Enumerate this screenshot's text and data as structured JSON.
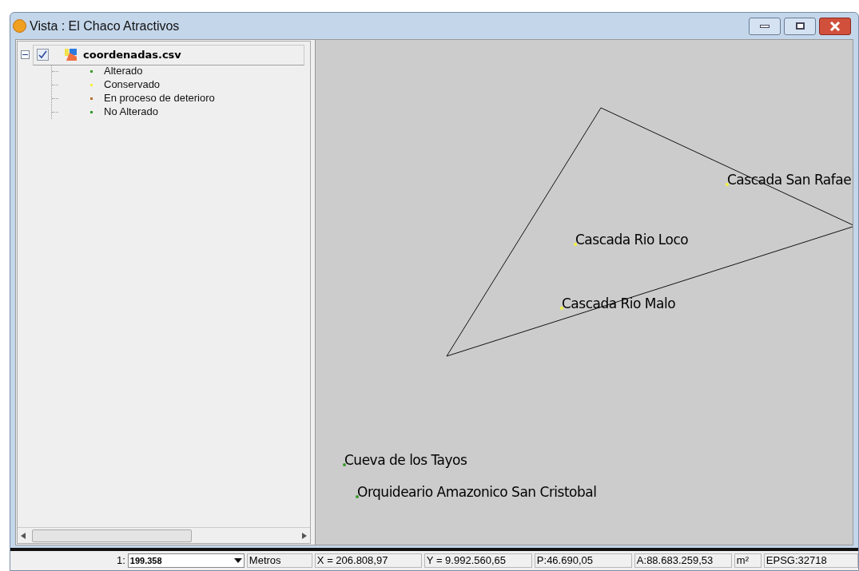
{
  "window": {
    "title": "Vista : El Chaco Atractivos"
  },
  "layers": [
    {
      "name": "coordenadas.csv",
      "checked": true,
      "expanded": true,
      "legend": [
        {
          "label": "Alterado",
          "color": "#3c9c2c"
        },
        {
          "label": "Conservado",
          "color": "#f2f23c"
        },
        {
          "label": "En proceso de deterioro",
          "color": "#b8702c"
        },
        {
          "label": "No Alterado",
          "color": "#2c9a2c"
        }
      ]
    }
  ],
  "map": {
    "features": [
      {
        "kind": "polygon"
      },
      {
        "kind": "point",
        "label": "Cascada San Rafae",
        "color": "#f2f23c"
      },
      {
        "kind": "point",
        "label": "Cascada Rio Loco",
        "color": "#f2f23c"
      },
      {
        "kind": "point",
        "label": "Cascada Rio Malo",
        "color": "#f2f23c"
      },
      {
        "kind": "point",
        "label": "Cueva de los Tayos",
        "color": "#3c9c2c"
      },
      {
        "kind": "point",
        "label": "Orquideario Amazonico San Cristobal",
        "color": "#3c9c2c"
      }
    ]
  },
  "status_bar": {
    "scale_prefix": "1:",
    "scale": "199.358",
    "units": "Metros",
    "x": "X = 206.808,97",
    "y": "Y = 9.992.560,65",
    "perimeter": "P:46.690,05",
    "area": "A:88.683.259,53",
    "area_units": "m²",
    "crs": "EPSG:32718"
  }
}
